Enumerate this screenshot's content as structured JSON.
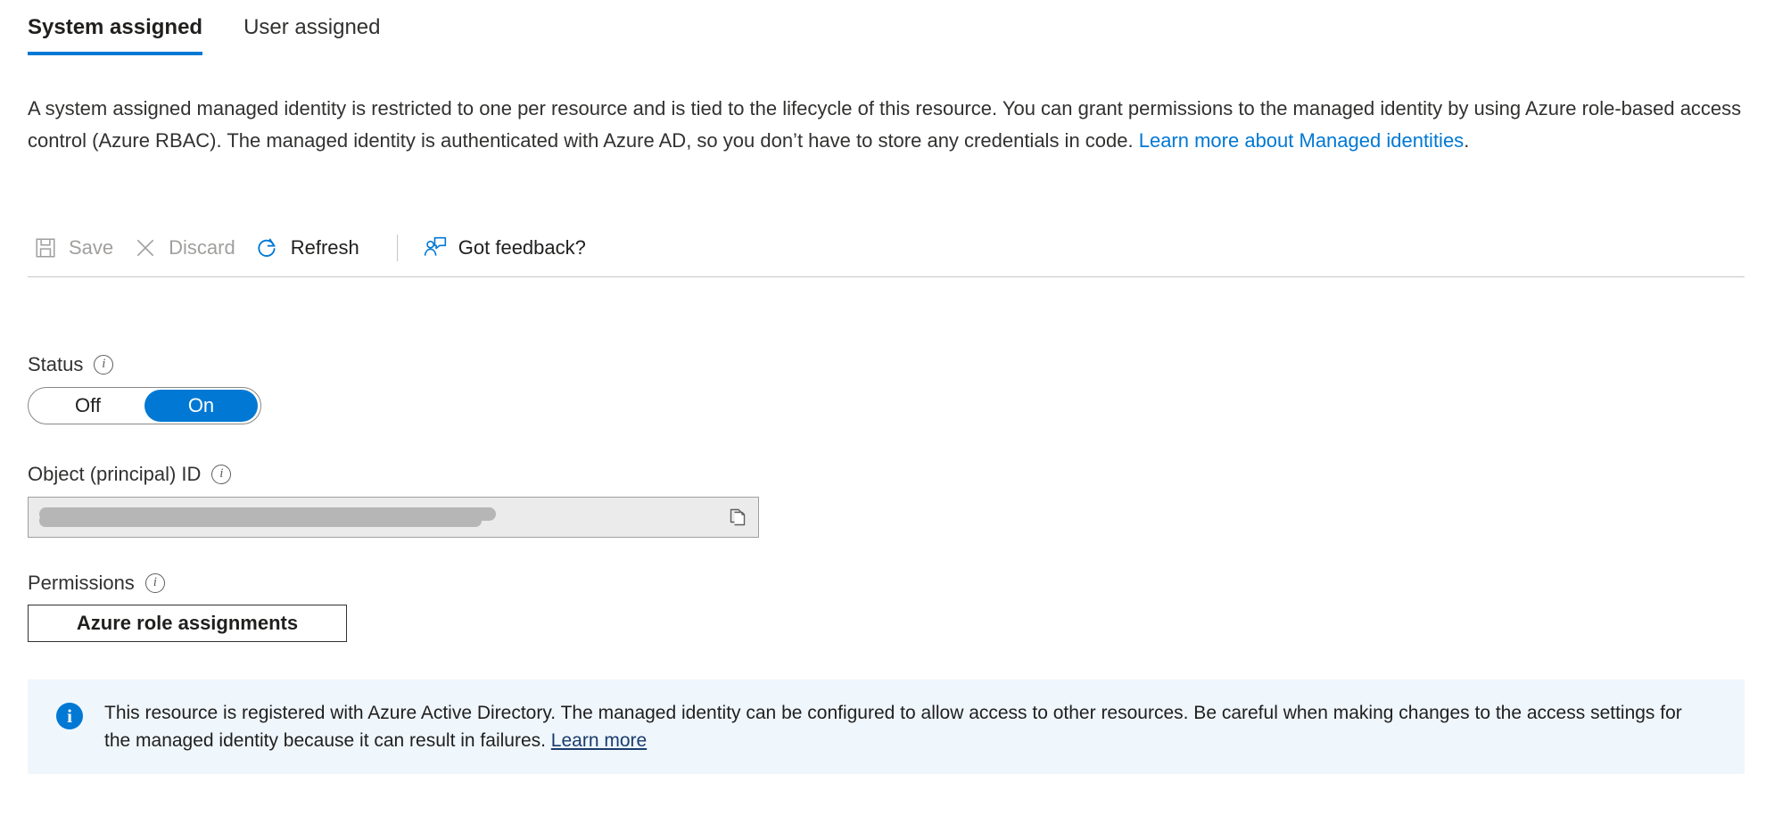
{
  "tabs": [
    {
      "label": "System assigned",
      "selected": true
    },
    {
      "label": "User assigned",
      "selected": false
    }
  ],
  "description": {
    "part1": "A system assigned managed identity is restricted to one per resource and is tied to the lifecycle of this resource. You can grant permissions to the managed identity by using Azure role-based access control (Azure RBAC). The managed identity is authenticated with Azure AD, so you don’t have to store any credentials in code. ",
    "link_text": "Learn more about Managed identities",
    "part2": "."
  },
  "commandbar": {
    "save": {
      "label": "Save",
      "icon": "save-icon",
      "disabled": true
    },
    "discard": {
      "label": "Discard",
      "icon": "close-icon",
      "disabled": true
    },
    "refresh": {
      "label": "Refresh",
      "icon": "refresh-icon",
      "disabled": false
    },
    "feedback": {
      "label": "Got feedback?",
      "icon": "feedback-person-icon",
      "disabled": false
    }
  },
  "status": {
    "label": "Status",
    "info_glyph": "i",
    "options": [
      {
        "label": "Off",
        "active": false
      },
      {
        "label": "On",
        "active": true
      }
    ],
    "value": "On"
  },
  "object_id": {
    "label": "Object (principal) ID",
    "info_glyph": "i",
    "value": "",
    "copy_icon": "copy-icon"
  },
  "permissions": {
    "label": "Permissions",
    "info_glyph": "i",
    "button_label": "Azure role assignments"
  },
  "banner": {
    "icon": "info-icon",
    "text": "This resource is registered with Azure Active Directory. The managed identity can be configured to allow access to other resources. Be careful when making changes to the access settings for the managed identity because it can result in failures. ",
    "link_text": "Learn more"
  },
  "colors": {
    "accent": "#0078d4",
    "link": "#0078d4",
    "banner_bg": "#eff6fc",
    "banner_link": "#1a3c6e",
    "disabled_text": "#a19f9d",
    "divider": "#c8c6c4"
  }
}
